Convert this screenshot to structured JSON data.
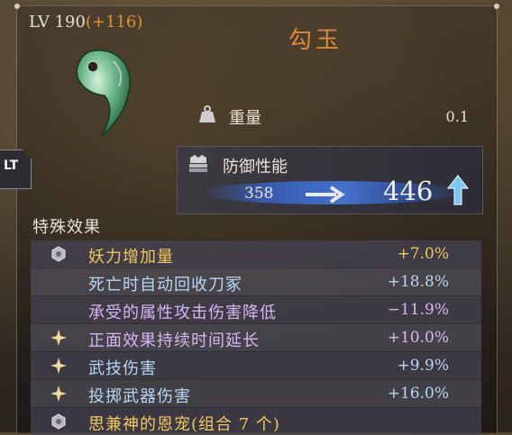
{
  "item": {
    "level_text": "LV 190",
    "level_bonus": "(+116)",
    "name": "勾玉",
    "icon": "magatama-icon"
  },
  "stats": {
    "weight_label": "重量",
    "weight_value": "0.1",
    "defense_label": "防御性能",
    "defense_old": "358",
    "defense_new": "446"
  },
  "nav": {
    "lt_label": "LT"
  },
  "effects": {
    "header": "特殊效果",
    "rows": [
      {
        "icon": "hexagon-icon",
        "name": "妖力增加量",
        "value": "+7.0%",
        "color": "#f0c860"
      },
      {
        "icon": "none",
        "name": "死亡时自动回收刀冢",
        "value": "+18.8%",
        "color": "#b8d6f4"
      },
      {
        "icon": "none",
        "name": "承受的属性攻击伤害降低",
        "value": "−11.9%",
        "color": "#d6b6f4"
      },
      {
        "icon": "sparkle-icon",
        "name": "正面效果持续时间延长",
        "value": "+10.0%",
        "color": "#d6b6f4"
      },
      {
        "icon": "sparkle-icon",
        "name": "武技伤害",
        "value": "+9.9%",
        "color": "#b8d6f4"
      },
      {
        "icon": "sparkle-icon",
        "name": "投掷武器伤害",
        "value": "+16.0%",
        "color": "#b8d6f4"
      },
      {
        "icon": "hexagon-icon",
        "name": "思兼神的恩宠(组合 7 个)",
        "value": "",
        "color": "#f0c860"
      }
    ]
  }
}
